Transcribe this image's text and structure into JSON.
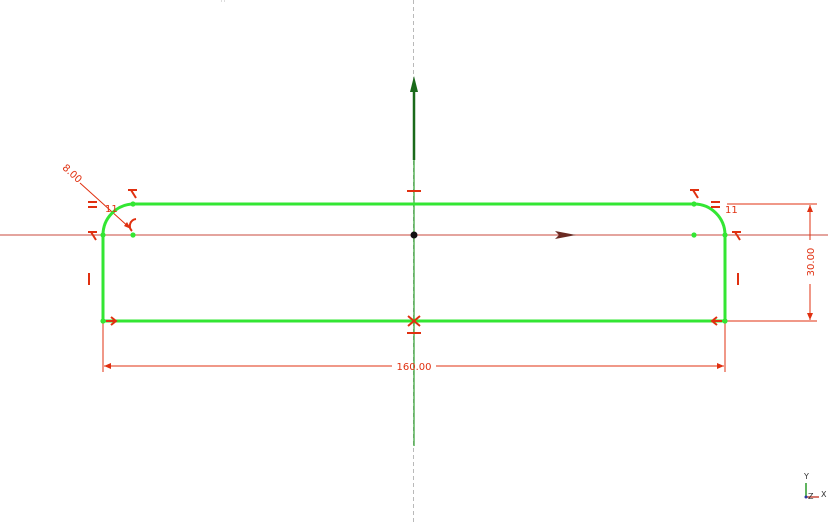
{
  "canvas": {
    "background": "#ffffff",
    "colors": {
      "profile": "#33e633",
      "constraint": "#e03010",
      "axis_horizontal": "#c84a3c",
      "axis_vertical": "#2a9a2a",
      "origin": "#111111"
    }
  },
  "dimensions": {
    "radius": "8.00",
    "height": "30.00",
    "width": "160.00"
  },
  "constraint_labels": {
    "left_index": "11",
    "right_index": "11"
  },
  "triad": {
    "y_label": "Y",
    "z_label": "Z",
    "x_label": "X"
  }
}
